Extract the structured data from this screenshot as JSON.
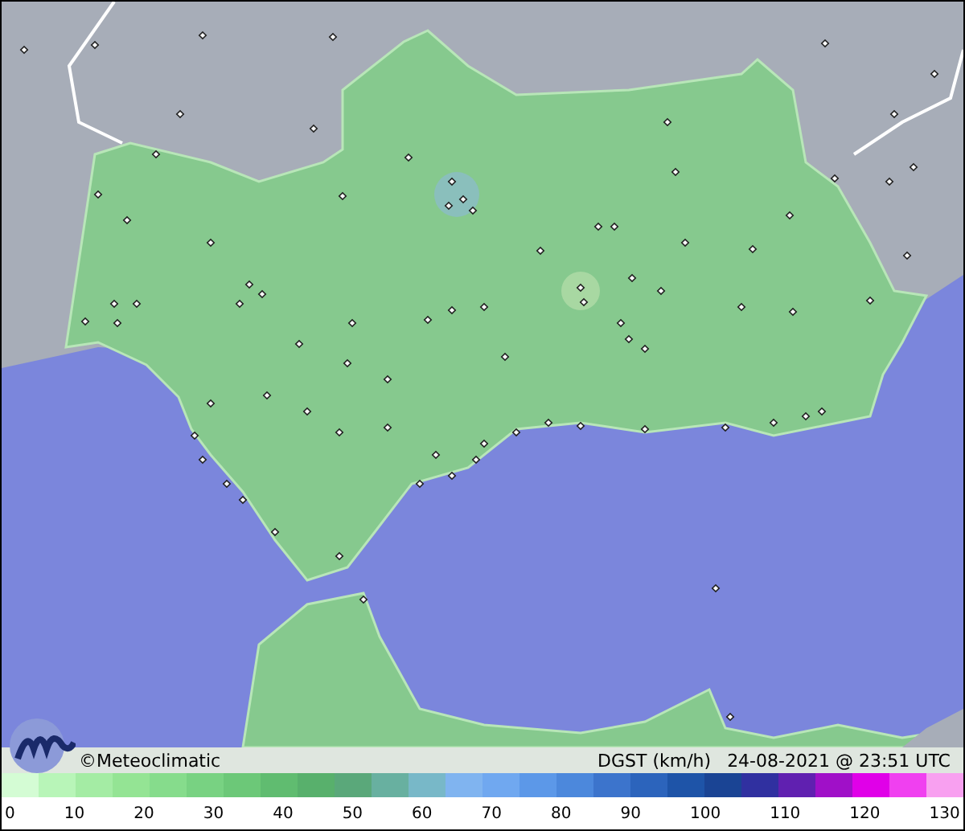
{
  "credit": "©Meteoclimatic",
  "variable": "DGST (km/h)",
  "timestamp": "24-08-2021 @ 23:51 UTC",
  "legend": {
    "bins": [
      {
        "color": "#d4fcd4"
      },
      {
        "color": "#b8f5b8"
      },
      {
        "color": "#a4eca4"
      },
      {
        "color": "#94e494"
      },
      {
        "color": "#86dc8c"
      },
      {
        "color": "#78d282"
      },
      {
        "color": "#6cc878"
      },
      {
        "color": "#60bc70"
      },
      {
        "color": "#58b06c"
      },
      {
        "color": "#5aa87a"
      },
      {
        "color": "#68b0a0"
      },
      {
        "color": "#78b8c8"
      },
      {
        "color": "#80b4f0"
      },
      {
        "color": "#70a8f0"
      },
      {
        "color": "#5c98e8"
      },
      {
        "color": "#4c88dc"
      },
      {
        "color": "#3c74cc"
      },
      {
        "color": "#2c64bc"
      },
      {
        "color": "#1e54a8"
      },
      {
        "color": "#1a4494"
      },
      {
        "color": "#3030a0"
      },
      {
        "color": "#6020b0"
      },
      {
        "color": "#a010c8"
      },
      {
        "color": "#e000e8"
      },
      {
        "color": "#f040f0"
      },
      {
        "color": "#f8a0f0"
      }
    ],
    "ticks": [
      "0",
      "10",
      "20",
      "30",
      "40",
      "50",
      "60",
      "70",
      "80",
      "90",
      "100",
      "110",
      "120",
      "130"
    ]
  }
}
